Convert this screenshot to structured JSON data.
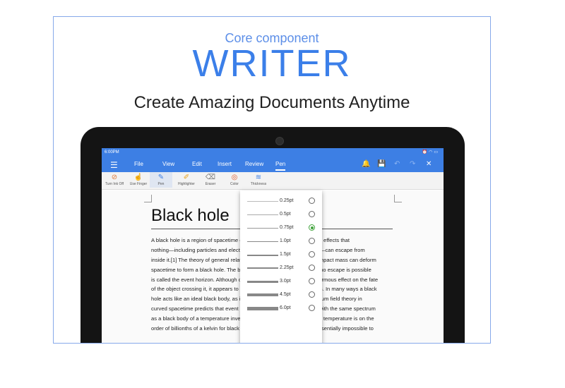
{
  "header": {
    "subtitle": "Core component",
    "title": "WRITER",
    "tagline": "Create Amazing Documents Anytime"
  },
  "statusbar": {
    "time": "6:00PM"
  },
  "menubar": {
    "items": [
      "File",
      "View",
      "Edit",
      "Insert",
      "Review",
      "Pen"
    ],
    "active": "Pen"
  },
  "toolbar": {
    "tools": [
      "Turn Ink Off",
      "Use Finger",
      "Pen",
      "Highlighter",
      "Eraser",
      "Color",
      "Thickness"
    ],
    "active": "Pen"
  },
  "document": {
    "title": "Black hole",
    "paragraph_lines": [
      "A black hole is a region of spacetime exhibiting such strong gravitational effects that",
      "nothing—including particles and electromagnetic radiation such as light—can escape from",
      "inside it.[1] The theory of general relativity predicts that a sufficiently compact mass can deform",
      "spacetime to form a black hole. The boundary of the region from which no escape is possible",
      "is called the event horizon. Although crossing the event horizon has enormous effect on the fate",
      "of the object crossing it, it appears to have no locally detectable features. In many ways a black",
      "hole acts like an ideal black body, as it reflects no light. Moreover, quantum field theory in",
      "curved spacetime predicts that event horizons emit Hawking radiation, with the same spectrum",
      "as a black body of a temperature inversely proportional to its mass. This temperature is on the",
      "order of billionths of a kelvin for black holes of stellar mass, making it essentially impossible to"
    ]
  },
  "thickness_dropdown": {
    "options": [
      "0.25pt",
      "0.5pt",
      "0.75pt",
      "1.0pt",
      "1.5pt",
      "2.25pt",
      "3.0pt",
      "4.5pt",
      "6.0pt"
    ],
    "selected": "0.75pt"
  },
  "colors": {
    "brand_blue": "#3b7fe9",
    "menubar_blue": "#3d7fe4",
    "radio_selected": "#3fa33a",
    "highlight_green": "#77c46f"
  }
}
